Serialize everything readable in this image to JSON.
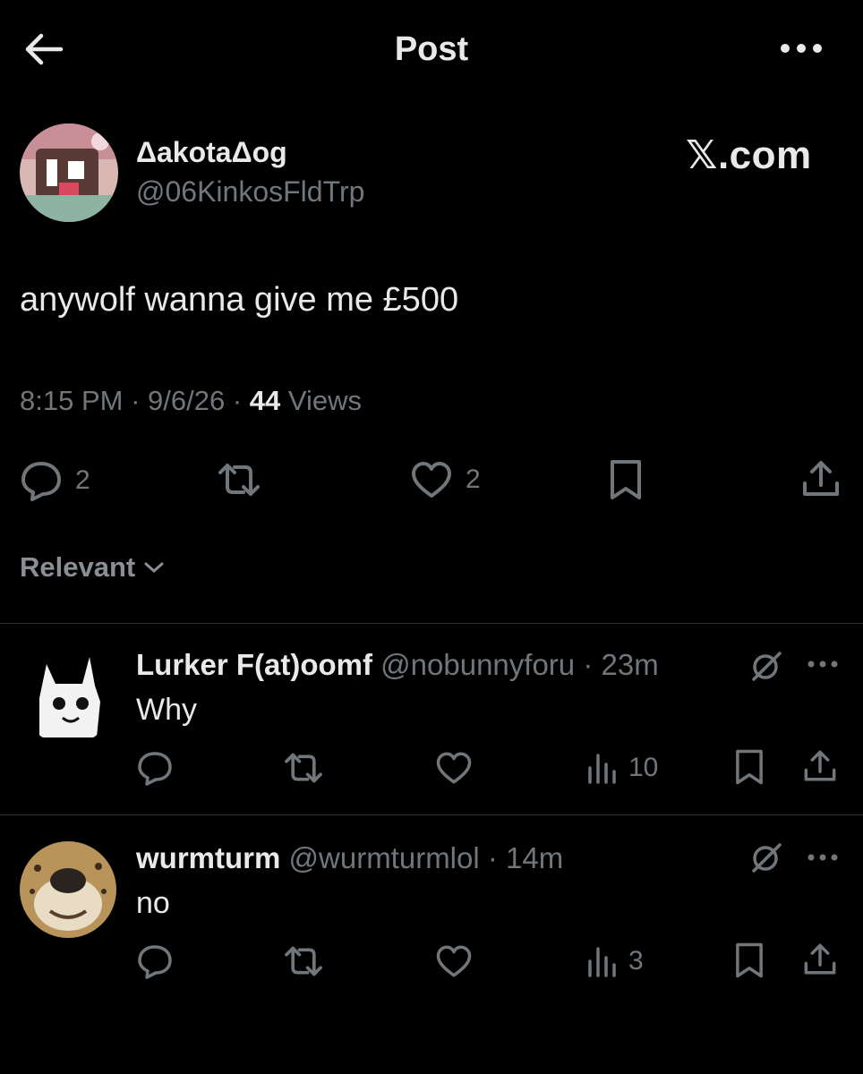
{
  "header": {
    "title": "Post",
    "back_icon": "arrow-left-icon",
    "more_icon": "more-horizontal-icon"
  },
  "post": {
    "author_name": "ΔakotaΔog",
    "author_handle": "@06KinkosFldTrp",
    "source_watermark": "𝕏.com",
    "text": "anywolf wanna give me £500",
    "time": "8:15 PM",
    "date": "9/6/26",
    "sep": " · ",
    "views_count": "44",
    "views_label": " Views",
    "actions": {
      "reply_count": "2",
      "like_count": "2"
    }
  },
  "replies_filter": {
    "label": "Relevant"
  },
  "replies": [
    {
      "name": "Lurker F(at)oomf",
      "handle": "@nobunnyforu",
      "time": "· 23m",
      "text": "Why",
      "views": "10"
    },
    {
      "name": "wurmturm",
      "handle": "@wurmturmlol",
      "time": "· 14m",
      "text": "no",
      "views": "3"
    }
  ],
  "colors": {
    "background": "#000000",
    "text": "#e7e9ea",
    "secondary": "#71767b",
    "divider": "#2f3336"
  }
}
